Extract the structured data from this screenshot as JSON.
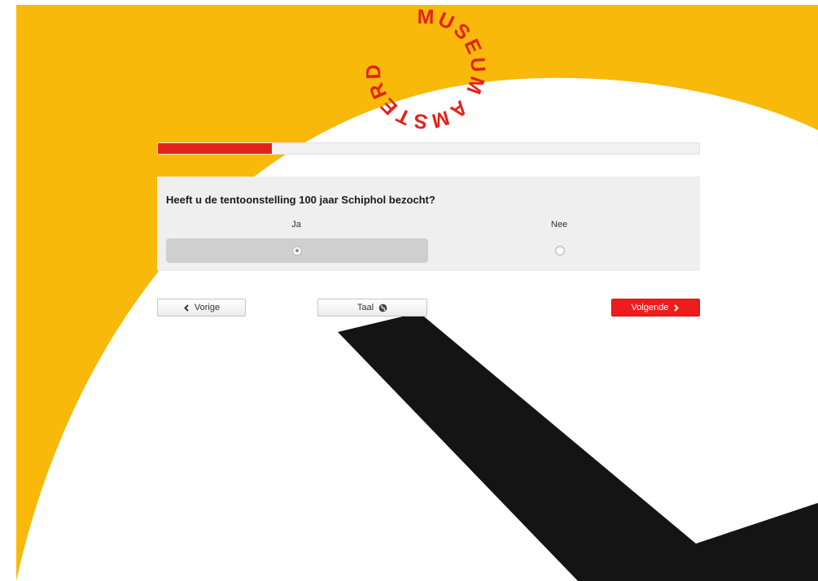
{
  "logo": {
    "text": "MUSEUM AMSTERDAM",
    "color": "#e2231a"
  },
  "colors": {
    "background_yellow": "#f9b90a",
    "accent_red": "#e2231a",
    "plane_black": "#141414"
  },
  "progress": {
    "fraction": 0.21
  },
  "question": {
    "text": "Heeft u de tentoonstelling 100 jaar Schiphol bezocht?",
    "options": [
      {
        "label": "Ja",
        "selected": true
      },
      {
        "label": "Nee",
        "selected": false
      }
    ]
  },
  "nav": {
    "prev_label": "Vorige",
    "prev_icon": "chevron-left-icon",
    "language_label": "Taal",
    "language_icon": "globe-icon",
    "next_label": "Volgende",
    "next_icon": "chevron-right-icon"
  }
}
